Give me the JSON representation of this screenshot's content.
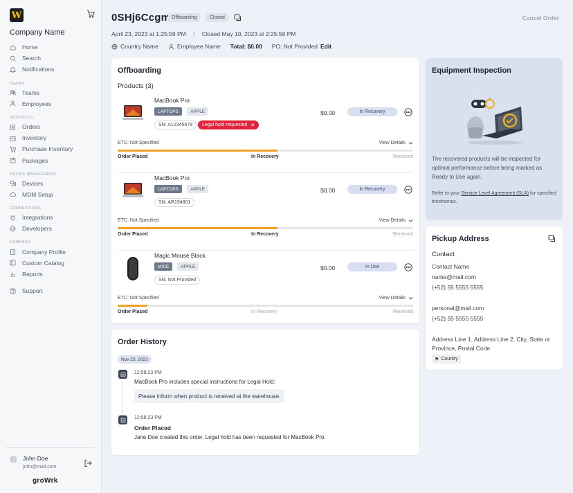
{
  "app": {
    "logo_letter": "W",
    "company": "Company Name",
    "brand": "groWrk"
  },
  "nav": {
    "items": [
      {
        "label": "Home",
        "icon": "home-icon"
      },
      {
        "label": "Search",
        "icon": "search-icon"
      },
      {
        "label": "Notifications",
        "icon": "bell-icon"
      }
    ],
    "sections": [
      {
        "title": "TEAMS",
        "items": [
          {
            "label": "Teams",
            "icon": "team-icon"
          },
          {
            "label": "Employees",
            "icon": "user-icon"
          }
        ]
      },
      {
        "title": "PRODUCTS",
        "items": [
          {
            "label": "Orders",
            "icon": "clipboard-icon"
          },
          {
            "label": "Inventory",
            "icon": "box-icon"
          },
          {
            "label": "Purchase Inventory",
            "icon": "cart-plus-icon"
          },
          {
            "label": "Packages",
            "icon": "package-icon"
          }
        ]
      },
      {
        "title": "DEVICE MANAGEMENT",
        "items": [
          {
            "label": "Devices",
            "icon": "devices-icon"
          },
          {
            "label": "MDM Setup",
            "icon": "cloud-icon"
          }
        ]
      },
      {
        "title": "CONNECTIONS",
        "items": [
          {
            "label": "Integrations",
            "icon": "plug-icon"
          },
          {
            "label": "Developers",
            "icon": "code-icon"
          }
        ]
      },
      {
        "title": "COMPANY",
        "items": [
          {
            "label": "Company Profile",
            "icon": "building-icon"
          },
          {
            "label": "Custom Catalog",
            "icon": "catalog-icon"
          },
          {
            "label": "Reports",
            "icon": "chart-icon"
          }
        ]
      }
    ],
    "support": {
      "label": "Support",
      "icon": "help-icon"
    }
  },
  "user": {
    "name": "John Doe",
    "email": "john@mail.com",
    "initial": "J"
  },
  "order": {
    "id": "0SHj6Ccgmd",
    "badge_type": "Offboarding",
    "badge_status": "Closed",
    "cancel_label": "Cancel Order",
    "created": "April 23, 2023  at 1:25:59 PM",
    "separator": "|",
    "closed": "Closed May 10, 2023 at 2:25:59 PM",
    "country": "Country Name",
    "employee": "Employee Name",
    "total": "Total: $0.00",
    "po": "PO: Not Provided",
    "edit": "Edit"
  },
  "offboarding": {
    "title": "Offboarding",
    "products_label": "Products (3)",
    "products": [
      {
        "name": "MacBook Pro",
        "category": "LAPTOPS",
        "brand": "APPLE",
        "sn": "SN: A12345678",
        "legal": "Legal hold requested",
        "price": "$0.00",
        "status": "In Recovery",
        "etc": "ETC: Not Specified",
        "details": "View Details",
        "progress": 0.54,
        "steps": [
          "Order Placed",
          "In Recovery",
          "Received"
        ],
        "active_steps": 2,
        "image": "laptop"
      },
      {
        "name": "MacBook Pro",
        "category": "LAPTOPS",
        "brand": "APPLE",
        "sn": "SN: AR194801",
        "legal": "",
        "price": "$0.00",
        "status": "In Recovery",
        "etc": "ETC: Not Specified",
        "details": "View Details",
        "progress": 0.54,
        "steps": [
          "Order Placed",
          "In Recovery",
          "Received"
        ],
        "active_steps": 2,
        "image": "laptop"
      },
      {
        "name": "Magic Mouse Black",
        "category": "MICE",
        "brand": "APPLE",
        "sn": "SN: Not Provided",
        "legal": "",
        "price": "$0.00",
        "status": "In Use",
        "etc": "ETC: Not Specified",
        "details": "View Details",
        "progress": 0.1,
        "steps": [
          "Order Placed",
          "In Recovery",
          "Received"
        ],
        "active_steps": 1,
        "image": "mouse"
      }
    ]
  },
  "history": {
    "title": "Order History",
    "date": "Nov 23, 2023",
    "entries": [
      {
        "time": "12:58:23 PM",
        "product": "MacBook Pro",
        "text": " includes special instructions for Legal Hold:",
        "note": "Please inform when product is received at the warehouse."
      },
      {
        "time": "12:58:23 PM",
        "title": "Order Placed",
        "text": "Jane Doe created this order. Legal hold has been requested for ",
        "product": "MacBook Pro",
        "suffix": "."
      }
    ]
  },
  "inspection": {
    "title": "Equipment Inspection",
    "body": [
      "The recovered products will be inspected for",
      "optimal performance before being marked as",
      "Ready to Use again."
    ],
    "sla_pre": "Refer to your ",
    "sla_link": "Service Level Agreement (SLA)",
    "sla_post": " for specified timeframes."
  },
  "pickup": {
    "title": "Pickup Address",
    "contact_label": "Contact",
    "contact_name": "Contact Name",
    "email": "name@mail.com",
    "phone": "(+52) 55 5555 5555",
    "personal_email": "personal@mail.com",
    "personal_phone": "(+52) 55 5555 5555",
    "address1": "Address Line 1, Address Line 2, City, State or",
    "address2": "Province, Postal Code",
    "country": "Country"
  },
  "colors": {
    "accent": "#f0a020",
    "legal": "#e0243c",
    "status_bg": "#d8dff0",
    "inspection_bg": "#d9e1ee"
  }
}
